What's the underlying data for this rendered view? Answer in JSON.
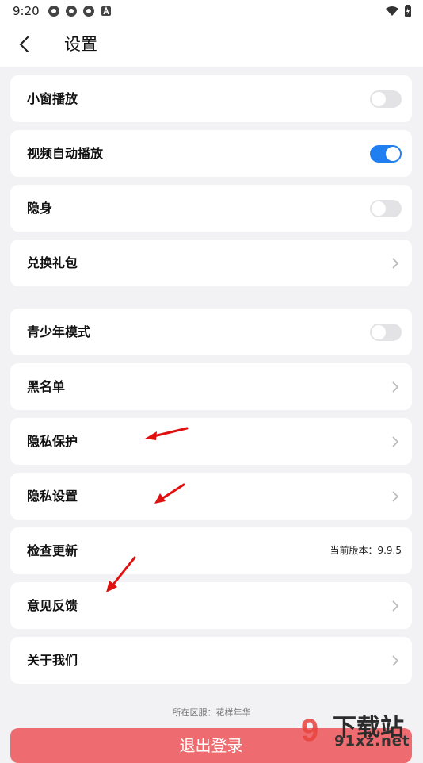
{
  "status": {
    "time": "9:20"
  },
  "header": {
    "title": "设置"
  },
  "items": [
    {
      "label": "小窗播放",
      "type": "toggle",
      "on": false
    },
    {
      "label": "视频自动播放",
      "type": "toggle",
      "on": true
    },
    {
      "label": "隐身",
      "type": "toggle",
      "on": false
    },
    {
      "label": "兑换礼包",
      "type": "link"
    },
    {
      "label": "青少年模式",
      "type": "toggle",
      "on": false
    },
    {
      "label": "黑名单",
      "type": "link"
    },
    {
      "label": "隐私保护",
      "type": "link"
    },
    {
      "label": "隐私设置",
      "type": "link"
    },
    {
      "label": "检查更新",
      "type": "info",
      "value": "当前版本：9.9.5"
    },
    {
      "label": "意见反馈",
      "type": "link"
    },
    {
      "label": "关于我们",
      "type": "link"
    }
  ],
  "footer": {
    "region": "所在区服：花样年华",
    "logout_label": "退出登录"
  },
  "watermark": {
    "brand": "下载站",
    "site": "91xz.net"
  },
  "colors": {
    "toggle_on": "#1f7ff0",
    "logout": "#ee6b6f",
    "arrow": "#e01010"
  }
}
